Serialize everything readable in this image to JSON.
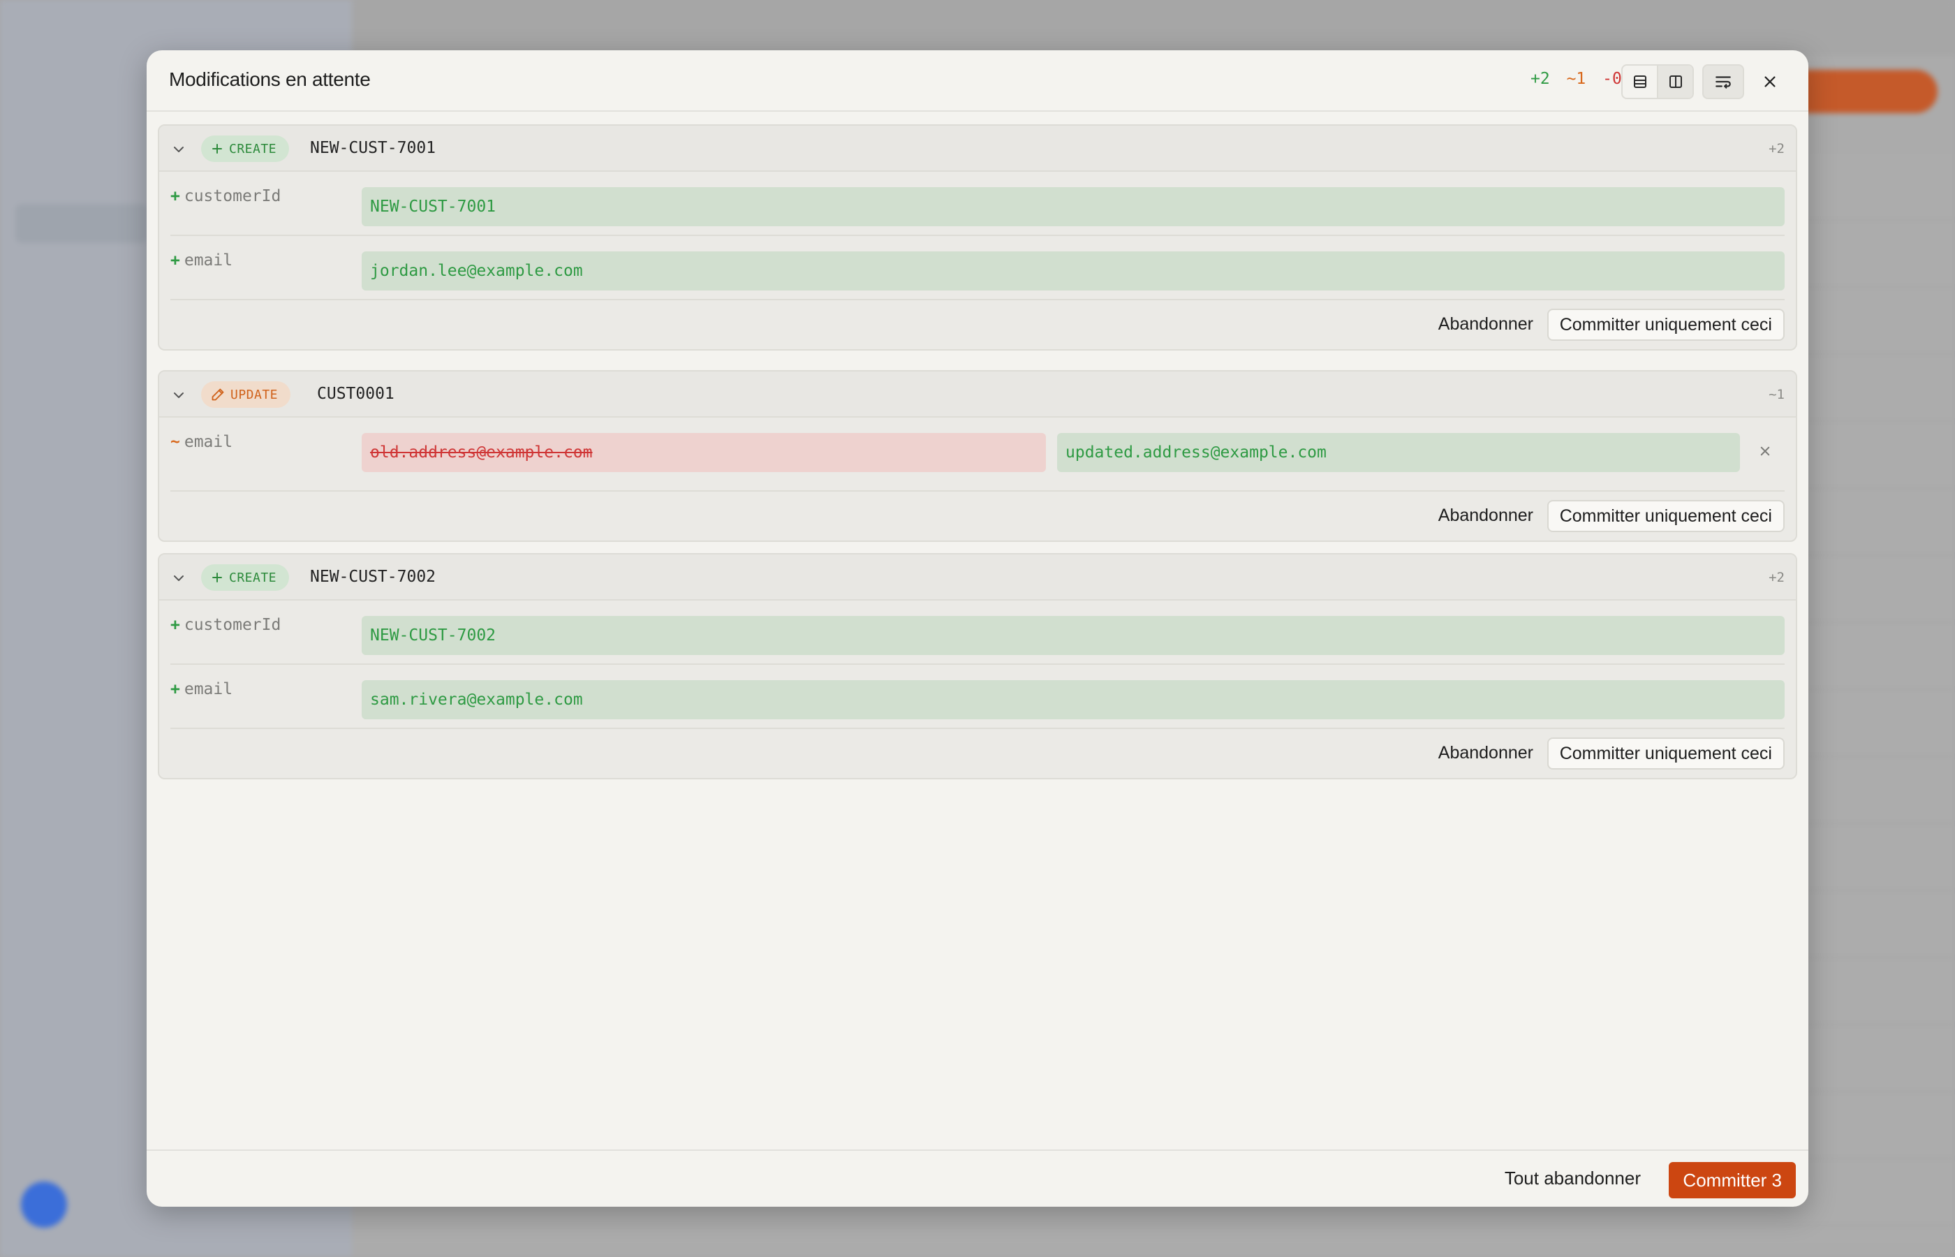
{
  "modal": {
    "title": "Modifications en attente",
    "stats": {
      "added": "+2",
      "modified": "~1",
      "deleted": "-0"
    }
  },
  "changes": [
    {
      "badge": "CREATE",
      "record_id": "NEW-CUST-7001",
      "count": "+2",
      "fields": [
        {
          "mark": "+",
          "name": "customerId",
          "value": "NEW-CUST-7001"
        },
        {
          "mark": "+",
          "name": "email",
          "value": "jordan.lee@example.com"
        }
      ]
    },
    {
      "badge": "UPDATE",
      "record_id": "CUST0001",
      "count": "~1",
      "fields": [
        {
          "mark": "~",
          "name": "email",
          "old_value": "old.address@example.com",
          "new_value": "updated.address@example.com"
        }
      ]
    },
    {
      "badge": "CREATE",
      "record_id": "NEW-CUST-7002",
      "count": "+2",
      "fields": [
        {
          "mark": "+",
          "name": "customerId",
          "value": "NEW-CUST-7002"
        },
        {
          "mark": "+",
          "name": "email",
          "value": "sam.rivera@example.com"
        }
      ]
    }
  ],
  "actions": {
    "discard": "Abandonner",
    "commit_one": "Committer uniquement ceci"
  },
  "footer": {
    "discard_all": "Tout abandonner",
    "commit_all": "Committer 3"
  },
  "icons": {
    "close": "close-icon",
    "unified_view": "rows-icon",
    "split_view": "columns-icon",
    "wrap": "wrap-text-icon",
    "collapse": "chevron-down-icon",
    "create": "plus-icon",
    "update": "pencil-icon"
  },
  "colors": {
    "added": "#2e9a43",
    "modified": "#d8681c",
    "deleted": "#cf3535",
    "primary": "#cc4611"
  }
}
